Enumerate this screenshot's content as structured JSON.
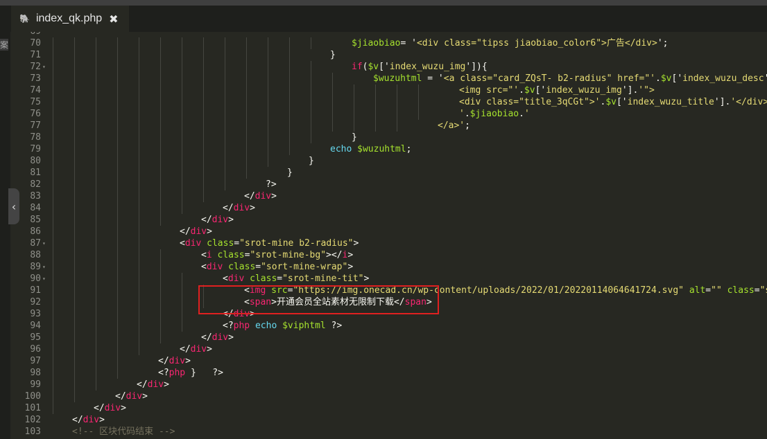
{
  "tab": {
    "filename": "index_qk.php",
    "icon": "php-elephant-icon",
    "close_glyph": "✖"
  },
  "sidebar": {
    "partial_text": "案",
    "collapse_glyph": "‹"
  },
  "annotation": {
    "color": "#e02020"
  },
  "lines": [
    {
      "n": "69",
      "fold": false,
      "ind": 0,
      "tokens": []
    },
    {
      "n": "70",
      "fold": false,
      "ind": 431,
      "tokens": [
        [
          "t-var",
          "$jiaobiao"
        ],
        [
          "t-punc",
          "= '"
        ],
        [
          "t-str",
          "<div class=\"tipss jiaobiao_color6\">广告</div>"
        ],
        [
          "t-punc",
          "';"
        ]
      ]
    },
    {
      "n": "71",
      "fold": false,
      "ind": 400,
      "tokens": [
        [
          "t-punc",
          "}"
        ]
      ]
    },
    {
      "n": "72",
      "fold": true,
      "ind": 431,
      "tokens": [
        [
          "t-kw",
          "if"
        ],
        [
          "t-punc",
          "("
        ],
        [
          "t-var",
          "$v"
        ],
        [
          "t-punc",
          "['"
        ],
        [
          "t-str",
          "index_wuzu_img"
        ],
        [
          "t-punc",
          "']){"
        ]
      ]
    },
    {
      "n": "73",
      "fold": false,
      "ind": 462,
      "tokens": [
        [
          "t-var",
          "$wuzuhtml"
        ],
        [
          "t-punc",
          " = '"
        ],
        [
          "t-str",
          "<a class=\"card_ZQsT- b2-radius\" href=\"'"
        ],
        [
          "t-punc",
          "."
        ],
        [
          "t-var",
          "$v"
        ],
        [
          "t-punc",
          "['"
        ],
        [
          "t-str",
          "index_wuzu_desc"
        ],
        [
          "t-punc",
          "']."
        ],
        [
          "t-str",
          "'\""
        ]
      ]
    },
    {
      "n": "74",
      "fold": false,
      "ind": 586,
      "tokens": [
        [
          "t-str",
          "<img src=\"'"
        ],
        [
          "t-punc",
          "."
        ],
        [
          "t-var",
          "$v"
        ],
        [
          "t-punc",
          "['"
        ],
        [
          "t-str",
          "index_wuzu_img"
        ],
        [
          "t-punc",
          "']."
        ],
        [
          "t-str",
          "'\">"
        ]
      ]
    },
    {
      "n": "75",
      "fold": false,
      "ind": 586,
      "tokens": [
        [
          "t-str",
          "<div class=\"title_3qCGt\">'"
        ],
        [
          "t-punc",
          "."
        ],
        [
          "t-var",
          "$v"
        ],
        [
          "t-punc",
          "['"
        ],
        [
          "t-str",
          "index_wuzu_title"
        ],
        [
          "t-punc",
          "']."
        ],
        [
          "t-str",
          "'</div>"
        ]
      ]
    },
    {
      "n": "76",
      "fold": false,
      "ind": 586,
      "tokens": [
        [
          "t-str",
          "'"
        ],
        [
          "t-punc",
          "."
        ],
        [
          "t-var",
          "$jiaobiao"
        ],
        [
          "t-punc",
          "."
        ],
        [
          "t-str",
          "'"
        ]
      ]
    },
    {
      "n": "77",
      "fold": false,
      "ind": 555,
      "tokens": [
        [
          "t-str",
          "</a>'"
        ],
        [
          "t-punc",
          ";"
        ]
      ]
    },
    {
      "n": "78",
      "fold": false,
      "ind": 431,
      "tokens": [
        [
          "t-punc",
          "}"
        ]
      ]
    },
    {
      "n": "79",
      "fold": false,
      "ind": 400,
      "tokens": [
        [
          "t-fn",
          "echo"
        ],
        [
          "t-punc",
          " "
        ],
        [
          "t-var",
          "$wuzuhtml"
        ],
        [
          "t-punc",
          ";"
        ]
      ]
    },
    {
      "n": "80",
      "fold": false,
      "ind": 369,
      "tokens": [
        [
          "t-punc",
          "}"
        ]
      ]
    },
    {
      "n": "81",
      "fold": false,
      "ind": 338,
      "tokens": [
        [
          "t-punc",
          "}"
        ]
      ]
    },
    {
      "n": "82",
      "fold": false,
      "ind": 307,
      "tokens": [
        [
          "t-punc",
          "?>"
        ]
      ]
    },
    {
      "n": "83",
      "fold": false,
      "ind": 276,
      "tokens": [
        [
          "t-punc",
          "</"
        ],
        [
          "t-tag",
          "div"
        ],
        [
          "t-punc",
          ">"
        ]
      ]
    },
    {
      "n": "84",
      "fold": false,
      "ind": 245,
      "tokens": [
        [
          "t-punc",
          "</"
        ],
        [
          "t-tag",
          "div"
        ],
        [
          "t-punc",
          ">"
        ]
      ]
    },
    {
      "n": "85",
      "fold": false,
      "ind": 214,
      "tokens": [
        [
          "t-punc",
          "</"
        ],
        [
          "t-tag",
          "div"
        ],
        [
          "t-punc",
          ">"
        ]
      ]
    },
    {
      "n": "86",
      "fold": false,
      "ind": 183,
      "tokens": [
        [
          "t-punc",
          "</"
        ],
        [
          "t-tag",
          "div"
        ],
        [
          "t-punc",
          ">"
        ]
      ]
    },
    {
      "n": "87",
      "fold": true,
      "ind": 183,
      "tokens": [
        [
          "t-punc",
          "<"
        ],
        [
          "t-tag",
          "div"
        ],
        [
          "t-punc",
          " "
        ],
        [
          "t-attr",
          "class"
        ],
        [
          "t-punc",
          "="
        ],
        [
          "t-str",
          "\"srot-mine b2-radius\""
        ],
        [
          "t-punc",
          ">"
        ]
      ]
    },
    {
      "n": "88",
      "fold": false,
      "ind": 214,
      "tokens": [
        [
          "t-punc",
          "<"
        ],
        [
          "t-tag",
          "i"
        ],
        [
          "t-punc",
          " "
        ],
        [
          "t-attr",
          "class"
        ],
        [
          "t-punc",
          "="
        ],
        [
          "t-str",
          "\"srot-mine-bg\""
        ],
        [
          "t-punc",
          "></"
        ],
        [
          "t-tag",
          "i"
        ],
        [
          "t-punc",
          ">"
        ]
      ]
    },
    {
      "n": "89",
      "fold": true,
      "ind": 214,
      "tokens": [
        [
          "t-punc",
          "<"
        ],
        [
          "t-tag",
          "div"
        ],
        [
          "t-punc",
          " "
        ],
        [
          "t-attr",
          "class"
        ],
        [
          "t-punc",
          "="
        ],
        [
          "t-str",
          "\"sort-mine-wrap\""
        ],
        [
          "t-punc",
          ">"
        ]
      ]
    },
    {
      "n": "90",
      "fold": true,
      "ind": 245,
      "tokens": [
        [
          "t-punc",
          "<"
        ],
        [
          "t-tag",
          "div"
        ],
        [
          "t-punc",
          " "
        ],
        [
          "t-attr",
          "class"
        ],
        [
          "t-punc",
          "="
        ],
        [
          "t-str",
          "\"srot-mine-tit\""
        ],
        [
          "t-punc",
          ">"
        ]
      ]
    },
    {
      "n": "91",
      "fold": false,
      "ind": 276,
      "tokens": [
        [
          "t-punc",
          "<"
        ],
        [
          "t-tag",
          "img"
        ],
        [
          "t-punc",
          " "
        ],
        [
          "t-attr",
          "src"
        ],
        [
          "t-punc",
          "="
        ],
        [
          "t-str",
          "\"https://img.onecad.cn/wp-content/uploads/2022/01/20220114064641724.svg\""
        ],
        [
          "t-punc",
          " "
        ],
        [
          "t-attr",
          "alt"
        ],
        [
          "t-punc",
          "="
        ],
        [
          "t-str",
          "\"\""
        ],
        [
          "t-punc",
          " "
        ],
        [
          "t-attr",
          "class"
        ],
        [
          "t-punc",
          "="
        ],
        [
          "t-str",
          "\"srot-mi"
        ]
      ]
    },
    {
      "n": "92",
      "fold": false,
      "ind": 276,
      "tokens": [
        [
          "t-punc",
          "<"
        ],
        [
          "t-tag",
          "span"
        ],
        [
          "t-punc",
          ">开通会员全站素材无限制下载</"
        ],
        [
          "t-tag",
          "span"
        ],
        [
          "t-punc",
          ">"
        ]
      ]
    },
    {
      "n": "93",
      "fold": false,
      "ind": 245,
      "tokens": [
        [
          "t-punc",
          "</"
        ],
        [
          "t-tag",
          "div"
        ],
        [
          "t-punc",
          ">"
        ]
      ]
    },
    {
      "n": "94",
      "fold": false,
      "ind": 245,
      "tokens": [
        [
          "t-punc",
          "<?"
        ],
        [
          "t-kw",
          "php"
        ],
        [
          "t-punc",
          " "
        ],
        [
          "t-fn",
          "echo"
        ],
        [
          "t-punc",
          " "
        ],
        [
          "t-var",
          "$viphtml"
        ],
        [
          "t-punc",
          " ?>"
        ]
      ]
    },
    {
      "n": "95",
      "fold": false,
      "ind": 214,
      "tokens": [
        [
          "t-punc",
          "</"
        ],
        [
          "t-tag",
          "div"
        ],
        [
          "t-punc",
          ">"
        ]
      ]
    },
    {
      "n": "96",
      "fold": false,
      "ind": 183,
      "tokens": [
        [
          "t-punc",
          "</"
        ],
        [
          "t-tag",
          "div"
        ],
        [
          "t-punc",
          ">"
        ]
      ]
    },
    {
      "n": "97",
      "fold": false,
      "ind": 152,
      "tokens": [
        [
          "t-punc",
          "</"
        ],
        [
          "t-tag",
          "div"
        ],
        [
          "t-punc",
          ">"
        ]
      ]
    },
    {
      "n": "98",
      "fold": false,
      "ind": 152,
      "tokens": [
        [
          "t-punc",
          "<?"
        ],
        [
          "t-kw",
          "php"
        ],
        [
          "t-punc",
          " }   ?>"
        ]
      ]
    },
    {
      "n": "99",
      "fold": false,
      "ind": 121,
      "tokens": [
        [
          "t-punc",
          "</"
        ],
        [
          "t-tag",
          "div"
        ],
        [
          "t-punc",
          ">"
        ]
      ]
    },
    {
      "n": "100",
      "fold": false,
      "ind": 90,
      "tokens": [
        [
          "t-punc",
          "</"
        ],
        [
          "t-tag",
          "div"
        ],
        [
          "t-punc",
          ">"
        ]
      ]
    },
    {
      "n": "101",
      "fold": false,
      "ind": 59,
      "tokens": [
        [
          "t-punc",
          "</"
        ],
        [
          "t-tag",
          "div"
        ],
        [
          "t-punc",
          ">"
        ]
      ]
    },
    {
      "n": "102",
      "fold": false,
      "ind": 28,
      "tokens": [
        [
          "t-punc",
          "</"
        ],
        [
          "t-tag",
          "div"
        ],
        [
          "t-punc",
          ">"
        ]
      ]
    },
    {
      "n": "103",
      "fold": false,
      "ind": 28,
      "tokens": [
        [
          "t-cmt",
          "<!-- 区块代码结束 -->"
        ]
      ]
    }
  ]
}
